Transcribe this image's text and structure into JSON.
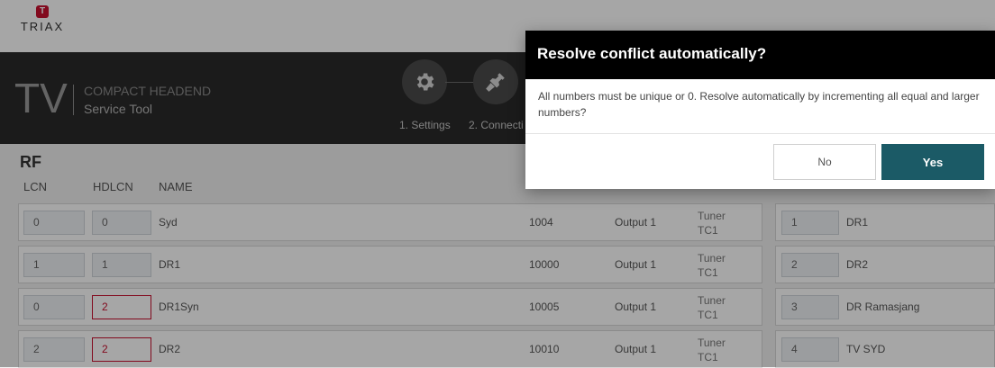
{
  "brand": {
    "logo_text": "TRIAX",
    "logo_mark": "T",
    "accent": "#c8102e"
  },
  "header": {
    "tv": "TV",
    "product": "COMPACT HEADEND",
    "subtitle": "Service Tool",
    "steps": [
      {
        "label": "1. Settings",
        "icon": "gear-icon"
      },
      {
        "label": "2. Connecti",
        "icon": "plug-icon"
      }
    ]
  },
  "rf": {
    "title": "RF",
    "columns": {
      "lcn": "LCN",
      "hdlcn": "HDLCN",
      "name": "NAME"
    },
    "rows": [
      {
        "lcn": "0",
        "hdlcn": "0",
        "hdlcn_error": false,
        "name": "Syd",
        "id": "1004",
        "destination": "Output 1",
        "source_line1": "Tuner",
        "source_line2": "TC1"
      },
      {
        "lcn": "1",
        "hdlcn": "1",
        "hdlcn_error": false,
        "name": "DR1",
        "id": "10000",
        "destination": "Output 1",
        "source_line1": "Tuner",
        "source_line2": "TC1"
      },
      {
        "lcn": "0",
        "hdlcn": "2",
        "hdlcn_error": true,
        "name": "DR1Syn",
        "id": "10005",
        "destination": "Output 1",
        "source_line1": "Tuner",
        "source_line2": "TC1"
      },
      {
        "lcn": "2",
        "hdlcn": "2",
        "hdlcn_error": true,
        "name": "DR2",
        "id": "10010",
        "destination": "Output 1",
        "source_line1": "Tuner",
        "source_line2": "TC1"
      }
    ],
    "right_rows": [
      {
        "num": "1",
        "name": "DR1"
      },
      {
        "num": "2",
        "name": "DR2"
      },
      {
        "num": "3",
        "name": "DR Ramasjang"
      },
      {
        "num": "4",
        "name": "TV SYD"
      }
    ]
  },
  "dialog": {
    "title": "Resolve conflict automatically?",
    "message": "All numbers must be unique or 0. Resolve automatically by incrementing all equal and larger numbers?",
    "no_label": "No",
    "yes_label": "Yes",
    "yes_color": "#1b5a66"
  }
}
